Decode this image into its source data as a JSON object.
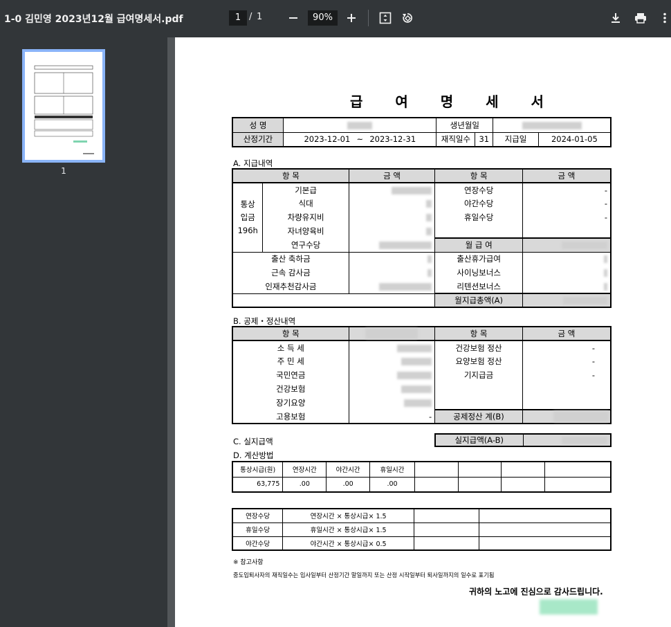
{
  "toolbar": {
    "filename": "1-0 김민영 2023년12월 급여명세서.pdf",
    "current_page": "1",
    "separator": "/",
    "total_pages": "1",
    "zoom": "90%"
  },
  "sidebar": {
    "thumb_label": "1"
  },
  "doc": {
    "title": "급 여 명 세 서",
    "info": {
      "name_label": "성  명",
      "birth_label": "생년월일",
      "period_label": "산정기간",
      "period_start": "2023-12-01",
      "period_tilde": "~",
      "period_end": "2023-12-31",
      "workdays_label": "재직일수",
      "workdays": "31",
      "paydate_label": "지급일",
      "paydate": "2024-01-05"
    },
    "a_label": "A. 지급내역",
    "a_headers": [
      "항    목",
      "금    액",
      "항    목",
      "금    액"
    ],
    "a_group": [
      "통상",
      "입금",
      "196h"
    ],
    "a_left": [
      "기본급",
      "식대",
      "차량유지비",
      "자녀양육비",
      "연구수당"
    ],
    "a_right": [
      "연장수당",
      "야간수당",
      "휴일수당"
    ],
    "a_right_values": [
      "-",
      "-",
      "-"
    ],
    "a_monthly": "월 급 여",
    "a_bonus_left": [
      "출산 축하금",
      "근속 감사금",
      "인재추천감사금"
    ],
    "a_bonus_right": [
      "출산휴가급여",
      "사이닝보너스",
      "리텐션보너스"
    ],
    "a_total": "월지급총액(A)",
    "b_label": "B. 공제・정산내역",
    "b_headers": [
      "항    목",
      "",
      "항    목",
      "금    액"
    ],
    "b_left": [
      "소 득 세",
      "주 민 세",
      "국민연금",
      "건강보험",
      "장기요양",
      "고용보험"
    ],
    "b_last_value": "-",
    "b_right": [
      "건강보험 정산",
      "요양보험 정산",
      "기지급금"
    ],
    "b_right_values": [
      "-",
      "-",
      "-"
    ],
    "b_total": "공제정산 계(B)",
    "c_label": "C. 실지급액",
    "c_total": "실지급액(A-B)",
    "d_label": "D. 계산방법",
    "d_headers": [
      "통상시급(원)",
      "연장시간",
      "야간시간",
      "휴일시간"
    ],
    "d_values": [
      "63,775",
      ".00",
      ".00",
      ".00"
    ],
    "e_rows": [
      [
        "연장수당",
        "연장시간 × 통상시급× 1.5"
      ],
      [
        "휴일수당",
        "휴일시간 × 통상시급× 1.5"
      ],
      [
        "야간수당",
        "야간시간 × 통상시급× 0.5"
      ]
    ],
    "note_title": "※ 참고사항",
    "note_text": "중도입퇴사자의 재직일수는 입사일부터 산정기간 말일까지 또는 산정 시작일부터 퇴사일까지의 일수로 표기됨",
    "thanks": "귀하의 노고에 진심으로 감사드립니다."
  }
}
